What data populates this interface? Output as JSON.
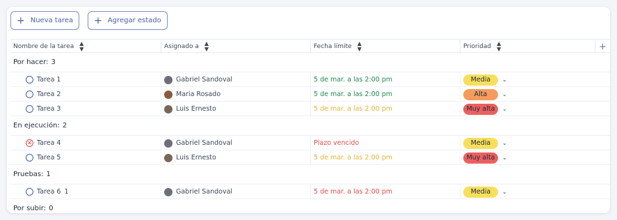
{
  "toolbar": {
    "new_task": "Nueva tarea",
    "add_state": "Agregar estado"
  },
  "columns": {
    "name": "Nombre de la tarea",
    "assigned": "Asignado a",
    "due": "Fecha límite",
    "priority": "Prioridad"
  },
  "colors": {
    "due_green": "#1f8a52",
    "due_yellow": "#e3b43a",
    "due_red": "#e24b4b",
    "media": "#f7df5b",
    "alta": "#f59c5c",
    "muy_alta": "#eb5f5f"
  },
  "groups": [
    {
      "label": "Por hacer:",
      "count": "3",
      "tasks": [
        {
          "name": "Tarea 1",
          "extra": "",
          "status": "open",
          "assignee": "Gabriel Sandoval",
          "avatar": "#6c6f7a",
          "due": "5 de mar. a las 2:00 pm",
          "due_color": "#1f8a52",
          "priority": "Media",
          "priority_color": "#f7df5b"
        },
        {
          "name": "Tarea 2",
          "extra": "",
          "status": "open",
          "assignee": "Maria Rosado",
          "avatar": "#8a5a3c",
          "due": "5 de mar. a las 2:00 pm",
          "due_color": "#1f8a52",
          "priority": "Alta",
          "priority_color": "#f59c5c"
        },
        {
          "name": "Tarea 3",
          "extra": "",
          "status": "open",
          "assignee": "Luis Ernesto",
          "avatar": "#7a6656",
          "due": "5 de mar. a las 2:00 pm",
          "due_color": "#e3b43a",
          "priority": "Muy alta",
          "priority_color": "#eb5f5f"
        }
      ]
    },
    {
      "label": "En ejecución:",
      "count": "2",
      "tasks": [
        {
          "name": "Tarea 4",
          "extra": "",
          "status": "error",
          "assignee": "Gabriel Sandoval",
          "avatar": "#6c6f7a",
          "due": "Plazo vencido",
          "due_color": "#e24b4b",
          "priority": "Media",
          "priority_color": "#f7df5b"
        },
        {
          "name": "Tarea 5",
          "extra": "",
          "status": "open",
          "assignee": "Luis Ernesto",
          "avatar": "#7a6656",
          "due": "5 de mar. a las 2:00 pm",
          "due_color": "#e3b43a",
          "priority": "Muy alta",
          "priority_color": "#eb5f5f"
        }
      ]
    },
    {
      "label": "Pruebas:",
      "count": "1",
      "tasks": [
        {
          "name": "Tarea 6",
          "extra": "1",
          "status": "open",
          "assignee": "Gabriel Sandoval",
          "avatar": "#6c6f7a",
          "due": "5 de mar. a las 2:00 pm",
          "due_color": "#e24b4b",
          "priority": "Media",
          "priority_color": "#f7df5b"
        }
      ]
    },
    {
      "label": "Por subir:",
      "count": "0",
      "tasks": []
    }
  ]
}
